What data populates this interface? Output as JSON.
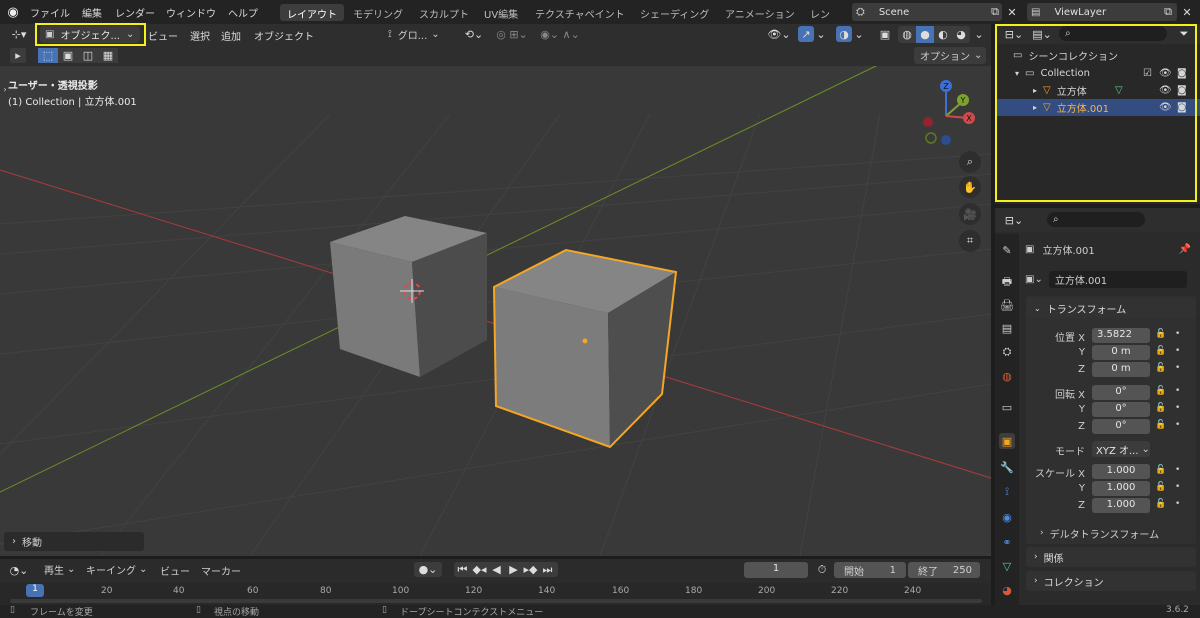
{
  "topbar": {
    "menus": [
      "ファイル",
      "編集",
      "レンダー",
      "ウィンドウ",
      "ヘルプ"
    ],
    "workspaces": [
      "レイアウト",
      "モデリング",
      "スカルプト",
      "UV編集",
      "テクスチャペイント",
      "シェーディング",
      "アニメーション",
      "レンダリ"
    ],
    "scene": "Scene",
    "view_layer": "ViewLayer"
  },
  "viewport": {
    "mode": "オブジェク...",
    "menus": [
      "ビュー",
      "選択",
      "追加",
      "オブジェクト"
    ],
    "transform_orientation": "グロ...",
    "options": "オプション",
    "view_title": "ユーザー・透視投影",
    "view_sub": "(1) Collection | 立方体.001",
    "gizmo": {
      "z": "Z",
      "y": "Y",
      "x": "X"
    },
    "last_op": "移動"
  },
  "outliner": {
    "scene_collection": "シーンコレクション",
    "collection": "Collection",
    "items": [
      "立方体",
      "立方体.001"
    ]
  },
  "properties": {
    "object_name_top": "立方体.001",
    "object_name": "立方体.001",
    "transform_header": "トランスフォーム",
    "location_label": "位置 X",
    "location": [
      "3.5822",
      "0 m",
      "0 m"
    ],
    "rotation_label": "回転 X",
    "rotation": [
      "0°",
      "0°",
      "0°"
    ],
    "mode_label": "モード",
    "mode_value": "XYZ オ...",
    "scale_label": "スケール X",
    "scale": [
      "1.000",
      "1.000",
      "1.000"
    ],
    "axis_y": "Y",
    "axis_z": "Z",
    "delta": "デルタトランスフォーム",
    "relations": "関係",
    "collections": "コレクション"
  },
  "timeline": {
    "play": "再生",
    "keying": "キーイング",
    "view": "ビュー",
    "marker": "マーカー",
    "current_frame": "1",
    "start_label": "開始",
    "start": "1",
    "end_label": "終了",
    "end": "250",
    "ticks": [
      "20",
      "40",
      "60",
      "80",
      "100",
      "120",
      "140",
      "160",
      "180",
      "200",
      "220",
      "240"
    ],
    "cursor": "1"
  },
  "status": {
    "left": "フレームを変更",
    "mid": "視点の移動",
    "right": "ドープシートコンテクストメニュー",
    "version": "3.6.2"
  },
  "colors": {
    "accent": "#4772b3",
    "selected_outline": "#f5a623",
    "highlight": "#f5f01a"
  }
}
